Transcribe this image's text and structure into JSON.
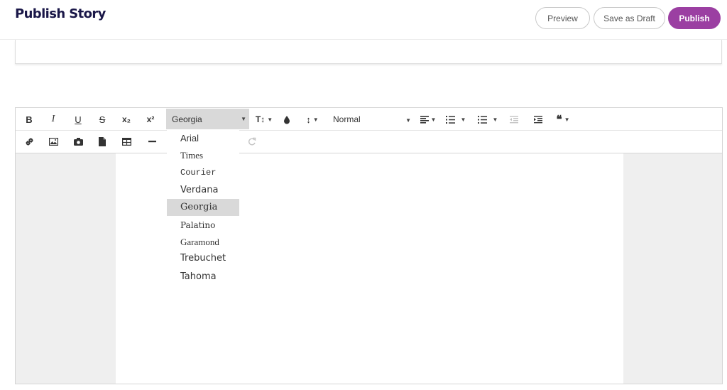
{
  "header": {
    "title": "Publish Story",
    "preview_label": "Preview",
    "draft_label": "Save as Draft",
    "publish_label": "Publish",
    "accent_color": "#9b3fa2",
    "title_color": "#1a1748"
  },
  "toolbar": {
    "bold": "B",
    "italic": "I",
    "underline": "U",
    "strikethrough": "S",
    "subscript": "x₂",
    "superscript": "x²",
    "font_family": "Georgia",
    "font_size_icon": "T↕",
    "text_color_icon": "droplet-icon",
    "line_height_icon": "↕",
    "paragraph_format": "Normal",
    "align_icon": "align-left-icon",
    "ordered_list_icon": "ordered-list-icon",
    "unordered_list_icon": "unordered-list-icon",
    "outdent_icon": "outdent-icon",
    "indent_icon": "indent-icon",
    "quote": "❝",
    "link_icon": "link-icon",
    "image_icon": "image-icon",
    "camera_icon": "camera-icon",
    "file_icon": "file-icon",
    "table_icon": "table-icon",
    "hr_icon": "horizontal-rule-icon",
    "redo_icon": "redo-icon"
  },
  "font_dropdown": {
    "selected": "Georgia",
    "options": [
      "Arial",
      "Times",
      "Courier",
      "Verdana",
      "Georgia",
      "Palatino",
      "Garamond",
      "Trebuchet",
      "Tahoma"
    ]
  }
}
